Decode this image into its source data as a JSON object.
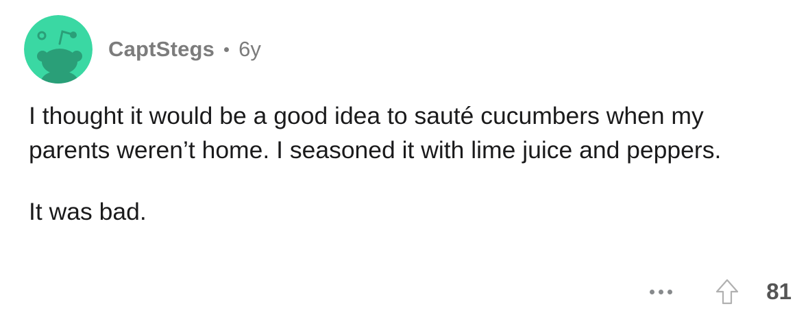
{
  "comment": {
    "author": "CaptStegs",
    "age": "6y",
    "paragraphs": [
      "I thought it would be a good idea to sauté cucumbers when my parents weren’t home. I seasoned it with lime juice and peppers.",
      "It was bad."
    ],
    "avatar_icon": "snoo-avatar-icon",
    "avatar_color": "#3ad8a3",
    "more_icon": "more-options-icon",
    "upvote_icon": "upvote-arrow-icon",
    "score": "81"
  }
}
